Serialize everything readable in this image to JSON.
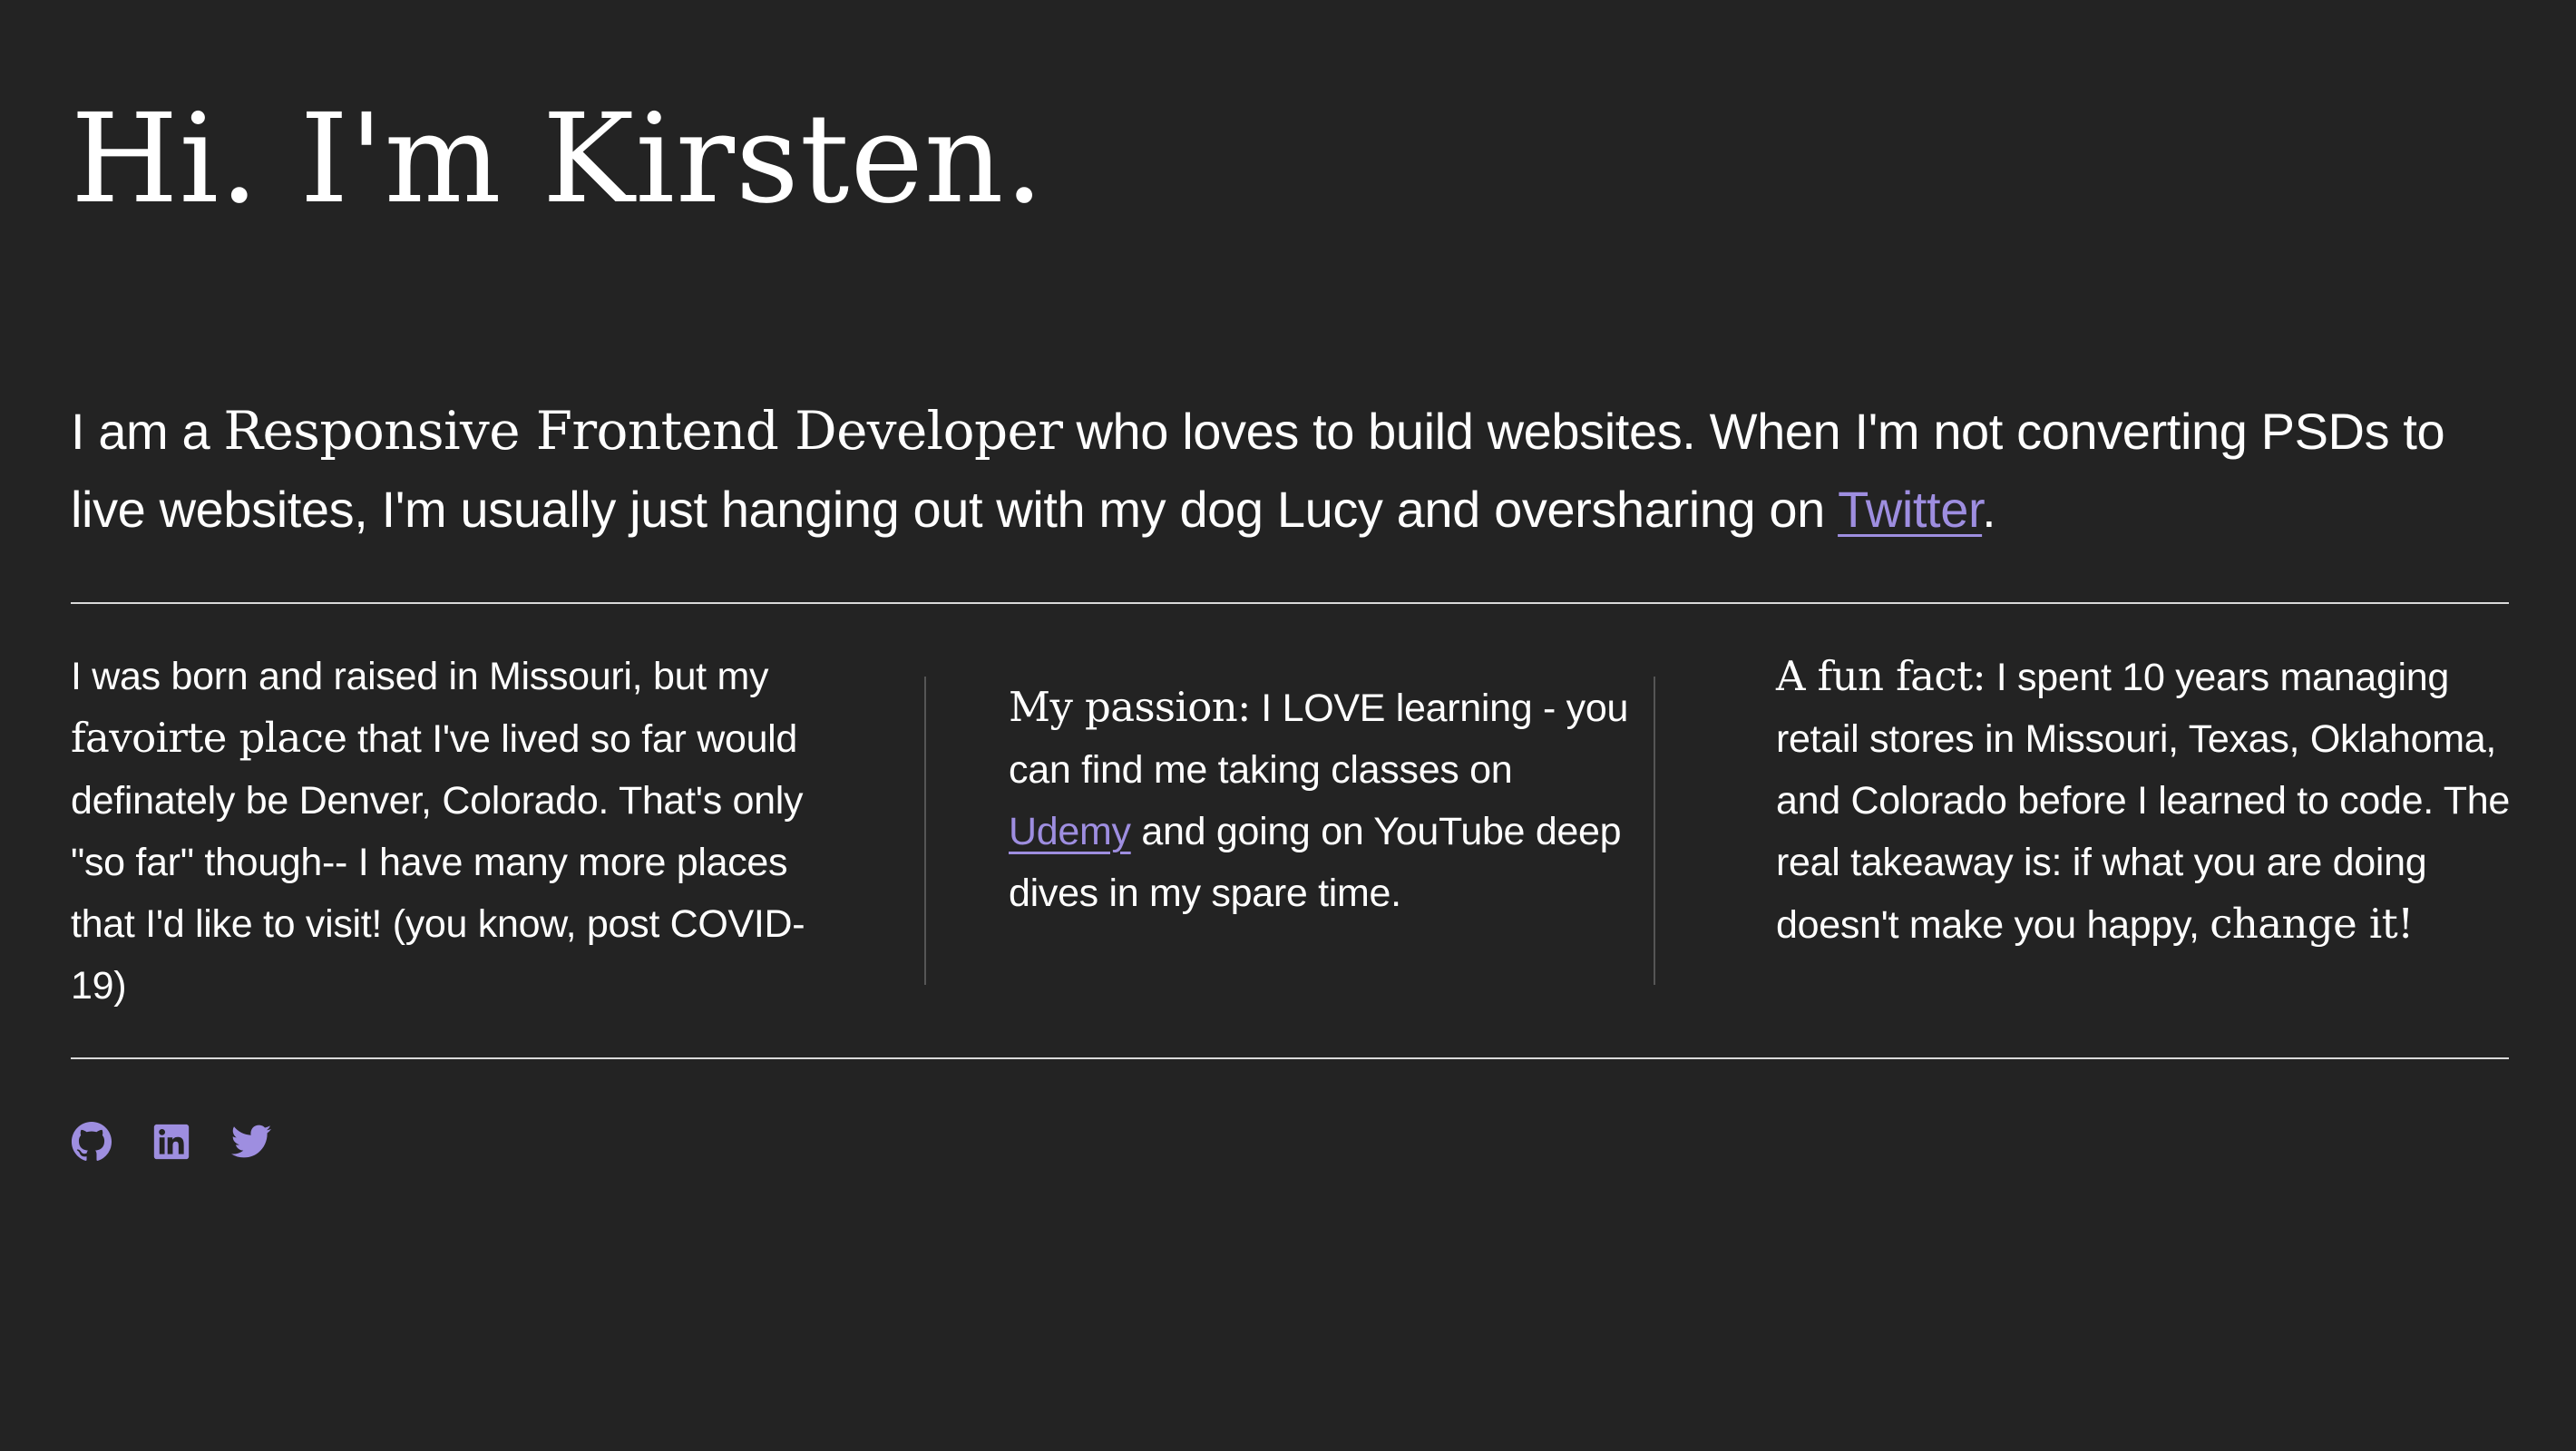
{
  "heading": "Hi. I'm Kirsten.",
  "intro": {
    "part1": "I am a ",
    "role": "Responsive Frontend Developer",
    "part2": " who loves to build websites. When I'm not converting PSDs to live websites, I'm usually just hanging out with my dog Lucy and oversharing on ",
    "twitter_link": "Twitter",
    "part3": "."
  },
  "columns": {
    "left": {
      "part1": "I was born and raised in Missouri, but my ",
      "serif": "favoirte place",
      "part2": " that I've lived so far would definately be Denver, Colorado. That's only \"so far\" though-- I have many more places that I'd like to visit! (you know, post COVID-19)"
    },
    "middle": {
      "label": "My passion:",
      "part1": " I LOVE learning - you can find me taking classes on ",
      "udemy_link": "Udemy",
      "part2": " and going on YouTube deep dives in my spare time."
    },
    "right": {
      "label": "A fun fact:",
      "part1": " I spent 10 years managing retail stores in Missouri, Texas, Oklahoma, and Colorado before I learned to code. The real takeaway is: if what you are doing doesn't make you happy, ",
      "serif": "change it!"
    }
  },
  "social": {
    "icons": [
      "github-icon",
      "linkedin-icon",
      "twitter-icon"
    ]
  },
  "colors": {
    "background": "#232323",
    "text": "#ffffff",
    "accent": "#9e8ee0",
    "rule": "#d9d9d9",
    "divider": "#555555"
  }
}
